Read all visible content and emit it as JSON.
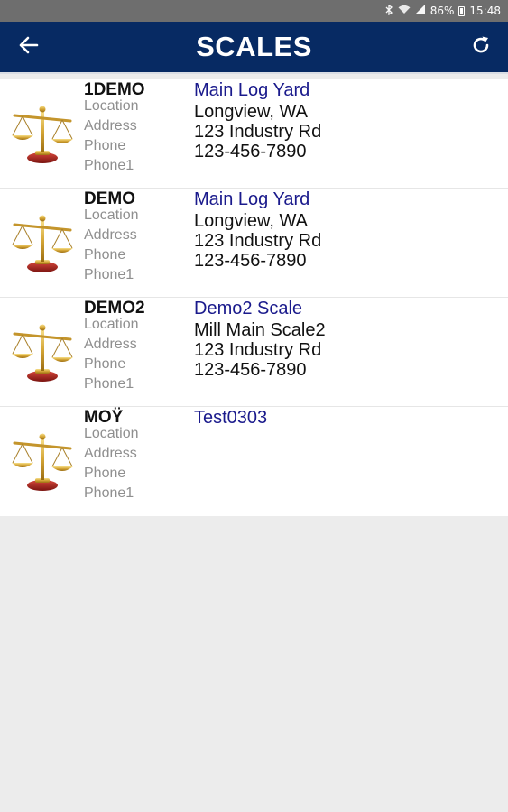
{
  "status_bar": {
    "battery": "86%",
    "time": "15:48"
  },
  "header": {
    "title": "SCALES",
    "back_icon": "arrow-left-icon",
    "refresh_icon": "refresh-icon"
  },
  "labels": {
    "location": "Location",
    "address": "Address",
    "phone": "Phone",
    "phone1": "Phone1"
  },
  "scales": [
    {
      "code": "1DEMO",
      "name": "Main Log Yard",
      "location": "Longview, WA",
      "address": "123 Industry Rd",
      "phone": "123-456-7890"
    },
    {
      "code": "DEMO",
      "name": "Main Log Yard",
      "location": "Longview, WA",
      "address": "123 Industry Rd",
      "phone": "123-456-7890"
    },
    {
      "code": "DEMO2",
      "name": "Demo2 Scale",
      "location": "Mill Main Scale2",
      "address": "123 Industry Rd",
      "phone": "123-456-7890"
    },
    {
      "code": "MOŸ",
      "name": "Test0303",
      "location": "",
      "address": "",
      "phone": ""
    }
  ],
  "colors": {
    "app_bar": "#072a63",
    "status_bar": "#6e6e6e",
    "scale_name": "#1a1a8c",
    "label": "#8f8f8f",
    "background": "#ececec"
  }
}
